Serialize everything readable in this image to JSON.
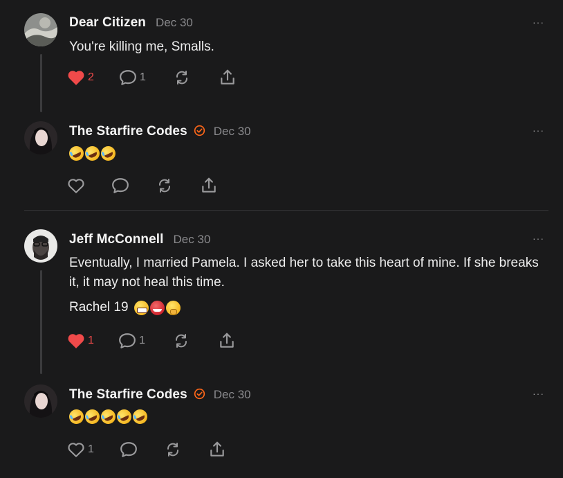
{
  "comments": [
    {
      "author": "Dear Citizen",
      "date": "Dec 30",
      "text": "You're killing me, Smalls.",
      "likes": "2",
      "replies": "1"
    },
    {
      "author": "The Starfire Codes",
      "date": "Dec 30",
      "emoji_count": 3
    },
    {
      "author": "Jeff McConnell",
      "date": "Dec 30",
      "text": "Eventually, I married Pamela. I asked her to take this heart of mine. If she breaks it, it may not heal this time.",
      "text2": "Rachel 19",
      "likes": "1",
      "replies": "1"
    },
    {
      "author": "The Starfire Codes",
      "date": "Dec 30",
      "likes": "1",
      "emoji_count": 5
    }
  ],
  "more_label": "···",
  "icons": [
    "heart-icon",
    "comment-icon",
    "restack-icon",
    "share-icon",
    "verified-icon",
    "more-icon"
  ],
  "colors": {
    "background": "#1a1a1b",
    "like": "#f04a4a",
    "verified": "#ff6719",
    "muted": "#8a8a8d"
  }
}
